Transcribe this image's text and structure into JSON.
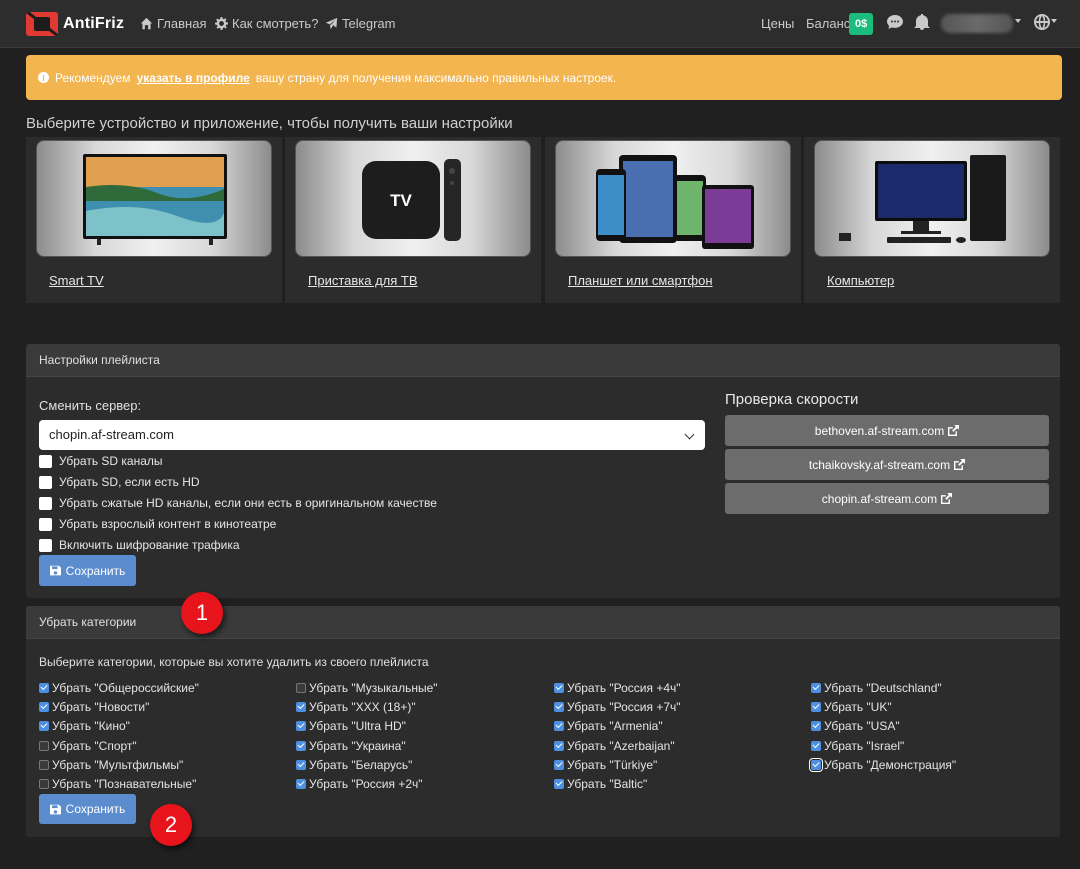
{
  "nav": {
    "brand": "AntiFriz",
    "home": "Главная",
    "how_to_watch": "Как смотреть?",
    "telegram": "Telegram",
    "prices": "Цены",
    "balance_label": "Баланс",
    "balance_value": "0$"
  },
  "alert": {
    "prefix": "Рекомендуем",
    "link": "указать в профиле",
    "suffix": "вашу страну для получения максимально правильных настроек."
  },
  "devices": {
    "title": "Выберите устройство и приложение, чтобы получить ваши настройки",
    "items": [
      {
        "label": "Smart TV"
      },
      {
        "label": "Приставка для ТВ"
      },
      {
        "label": "Планшет или смартфон"
      },
      {
        "label": "Компьютер"
      }
    ],
    "tv_box_text": "TV"
  },
  "playlist": {
    "header": "Настройки плейлиста",
    "server_label": "Сменить сервер:",
    "server_value": "chopin.af-stream.com",
    "options": [
      "Убрать SD каналы",
      "Убрать SD, если есть HD",
      "Убрать сжатые HD каналы, если они есть в оригинальном качестве",
      "Убрать взрослый контент в кинотеатре",
      "Включить шифрование трафика"
    ],
    "save": "Сохранить"
  },
  "speed": {
    "title": "Проверка скорости",
    "servers": [
      "bethoven.af-stream.com",
      "tchaikovsky.af-stream.com",
      "chopin.af-stream.com"
    ]
  },
  "categories": {
    "header": "Убрать категории",
    "description": "Выберите категории, которые вы хотите удалить из своего плейлиста",
    "columns": [
      [
        {
          "label": "Убрать \"Общероссийские\"",
          "checked": true
        },
        {
          "label": "Убрать \"Новости\"",
          "checked": true
        },
        {
          "label": "Убрать \"Кино\"",
          "checked": true
        },
        {
          "label": "Убрать \"Спорт\"",
          "checked": false
        },
        {
          "label": "Убрать \"Мультфильмы\"",
          "checked": false
        },
        {
          "label": "Убрать \"Познавательные\"",
          "checked": false
        }
      ],
      [
        {
          "label": "Убрать \"Музыкальные\"",
          "checked": false
        },
        {
          "label": "Убрать \"XXX (18+)\"",
          "checked": true
        },
        {
          "label": "Убрать \"Ultra HD\"",
          "checked": true
        },
        {
          "label": "Убрать \"Украина\"",
          "checked": true
        },
        {
          "label": "Убрать \"Беларусь\"",
          "checked": true
        },
        {
          "label": "Убрать \"Россия +2ч\"",
          "checked": true
        }
      ],
      [
        {
          "label": "Убрать \"Россия +4ч\"",
          "checked": true
        },
        {
          "label": "Убрать \"Россия +7ч\"",
          "checked": true
        },
        {
          "label": "Убрать \"Armenia\"",
          "checked": true
        },
        {
          "label": "Убрать \"Azerbaijan\"",
          "checked": true
        },
        {
          "label": "Убрать \"Türkiye\"",
          "checked": true
        },
        {
          "label": "Убрать \"Baltic\"",
          "checked": true
        }
      ],
      [
        {
          "label": "Убрать \"Deutschland\"",
          "checked": true
        },
        {
          "label": "Убрать \"UK\"",
          "checked": true
        },
        {
          "label": "Убрать \"USA\"",
          "checked": true
        },
        {
          "label": "Убрать \"Israel\"",
          "checked": true
        },
        {
          "label": "Убрать \"Демонстрация\"",
          "checked": true
        }
      ]
    ],
    "save": "Сохранить"
  },
  "markers": [
    "1",
    "2"
  ],
  "colors": {
    "alert": "#f2b550",
    "balance": "#1cbc7c",
    "primary": "#5b8dce",
    "marker": "#e8141c"
  },
  "icons": [
    "home-icon",
    "gear-icon",
    "telegram-icon",
    "chat-icon",
    "bell-icon",
    "globe-icon",
    "info-icon",
    "save-icon",
    "external-link-icon",
    "chevron-down-icon"
  ]
}
